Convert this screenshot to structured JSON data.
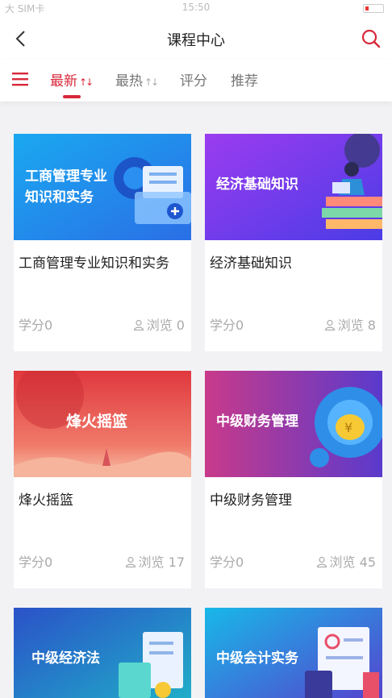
{
  "status_bar": {
    "time": "15:50",
    "carrier": "大 SIM卡"
  },
  "header": {
    "title": "课程中心"
  },
  "tabs": [
    {
      "label": "最新",
      "sort_icon": "sort-icon",
      "active": true
    },
    {
      "label": "最热",
      "sort_icon": "sort-icon",
      "active": false
    },
    {
      "label": "评分",
      "active": false
    },
    {
      "label": "推荐",
      "active": false
    }
  ],
  "accent": "#d8283a",
  "courses": [
    {
      "banner": "工商管理专业\n知识和实务",
      "name": "工商管理专业知识和实务",
      "credit": "学分0",
      "views": "浏览 0"
    },
    {
      "banner": "经济基础知识",
      "name": "经济基础知识",
      "credit": "学分0",
      "views": "浏览 8"
    },
    {
      "banner": "烽火摇篮",
      "name": "烽火摇篮",
      "credit": "学分0",
      "views": "浏览 17"
    },
    {
      "banner": "中级财务管理",
      "name": "中级财务管理",
      "credit": "学分0",
      "views": "浏览 45"
    },
    {
      "banner": "中级经济法",
      "name": "",
      "credit": "",
      "views": ""
    },
    {
      "banner": "中级会计实务",
      "name": "",
      "credit": "",
      "views": ""
    }
  ]
}
